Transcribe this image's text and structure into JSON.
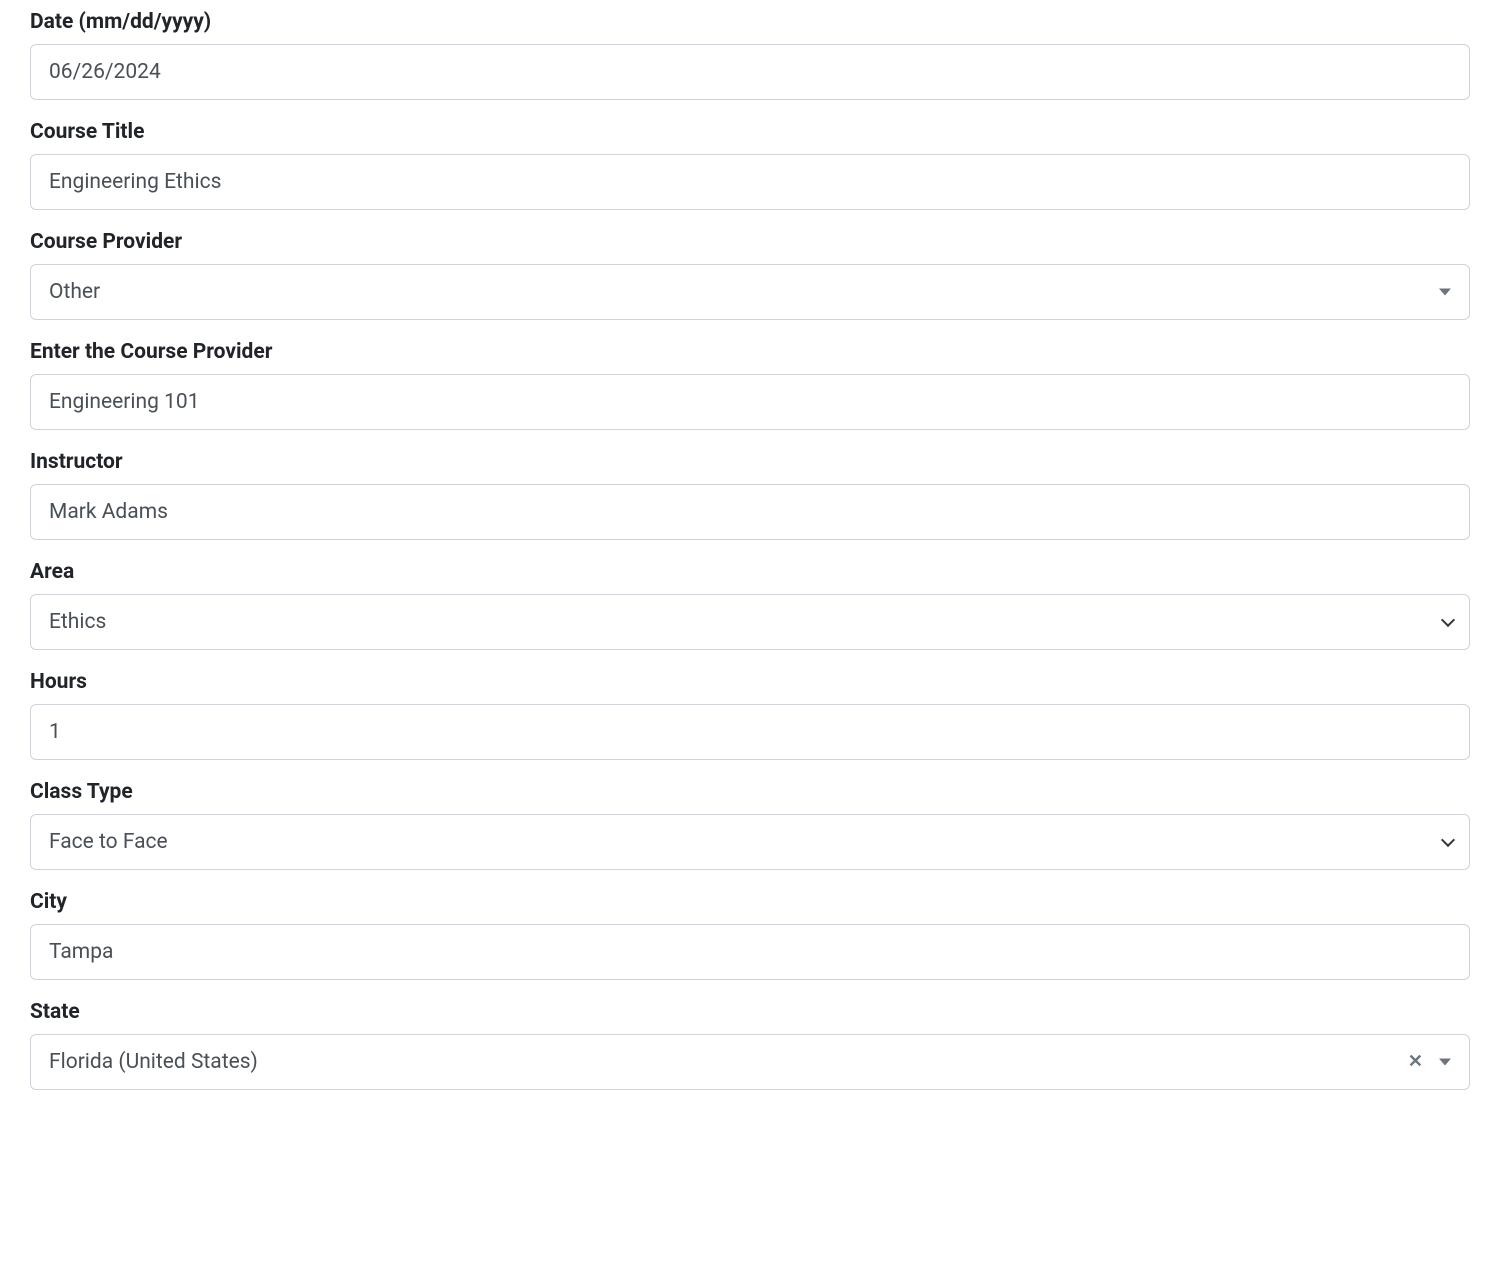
{
  "form": {
    "date": {
      "label": "Date (mm/dd/yyyy)",
      "value": "06/26/2024"
    },
    "course_title": {
      "label": "Course Title",
      "value": "Engineering Ethics"
    },
    "provider": {
      "label": "Course Provider",
      "value": "Other"
    },
    "provider_text": {
      "label": "Enter the Course Provider",
      "value": "Engineering 101"
    },
    "instructor": {
      "label": "Instructor",
      "value": "Mark Adams"
    },
    "area": {
      "label": "Area",
      "value": "Ethics"
    },
    "hours": {
      "label": "Hours",
      "value": "1"
    },
    "class_type": {
      "label": "Class Type",
      "value": "Face to Face"
    },
    "city": {
      "label": "City",
      "value": "Tampa"
    },
    "state": {
      "label": "State",
      "value": "Florida (United States)"
    }
  }
}
